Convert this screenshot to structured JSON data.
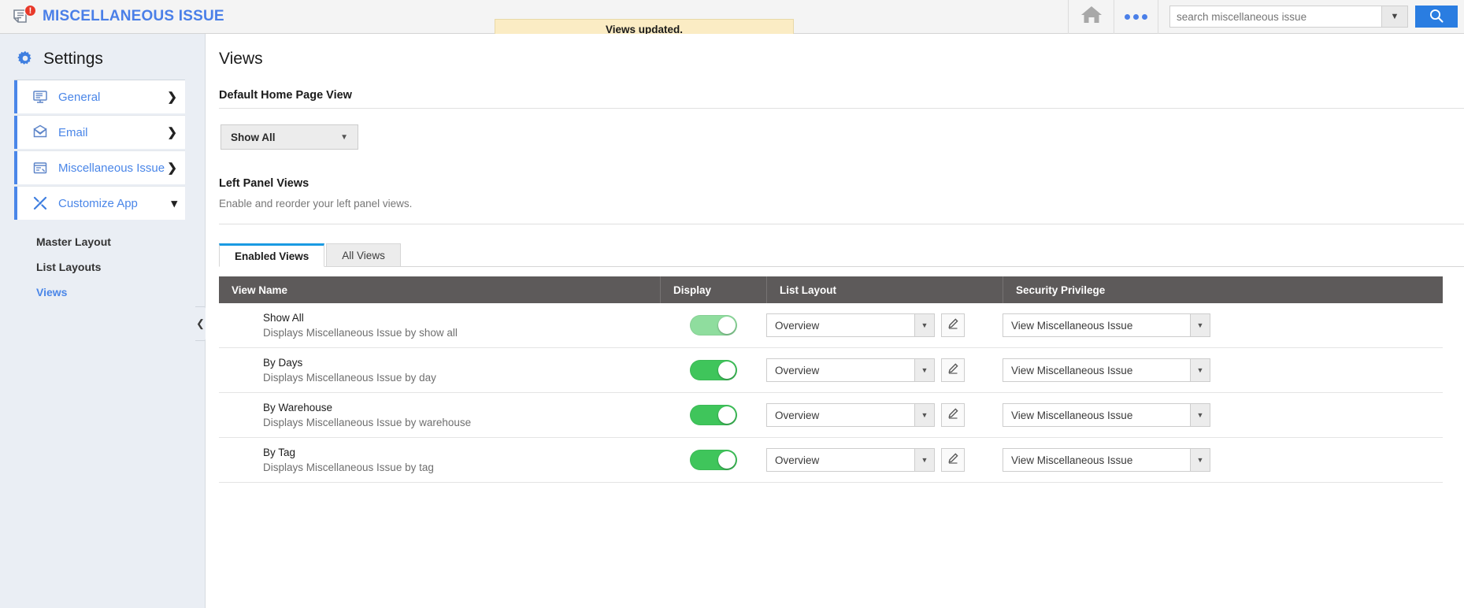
{
  "topbar": {
    "app_icon": "document-issue-icon",
    "badge_count": "!",
    "app_title": "MISCELLANEOUS ISSUE",
    "toast_message": "Views updated.",
    "home_icon": "home-icon",
    "more_icon": "more-options-icon",
    "search_placeholder": "search miscellaneous issue",
    "search_value": "",
    "search_dropdown_icon": "chevron-down-icon",
    "search_button_icon": "search-icon"
  },
  "sidebar": {
    "title": "Settings",
    "gear_icon": "gear-icon",
    "items": [
      {
        "label": "General",
        "icon": "monitor-icon",
        "chevron": "❯"
      },
      {
        "label": "Email",
        "icon": "envelope-icon",
        "chevron": "❯"
      },
      {
        "label": "Miscellaneous Issue",
        "icon": "window-list-icon",
        "chevron": "❯"
      },
      {
        "label": "Customize App",
        "icon": "tools-icon",
        "chevron": "❮"
      }
    ],
    "subnav": [
      {
        "label": "Master Layout",
        "active": false
      },
      {
        "label": "List Layouts",
        "active": false
      },
      {
        "label": "Views",
        "active": true
      }
    ],
    "collapse_icon": "chevron-left-icon"
  },
  "main": {
    "page_title": "Views",
    "default_home_section": {
      "label": "Default Home Page View",
      "select_value": "Show All",
      "caret_icon": "caret-down-icon"
    },
    "left_panel_section": {
      "label": "Left Panel Views",
      "description": "Enable and reorder your left panel views."
    },
    "tabs": [
      {
        "label": "Enabled Views",
        "active": true
      },
      {
        "label": "All Views",
        "active": false
      }
    ],
    "table": {
      "columns": [
        "View Name",
        "Display",
        "List Layout",
        "Security Privilege"
      ],
      "rows": [
        {
          "name": "Show All",
          "description": "Displays Miscellaneous Issue by show all",
          "display_on": true,
          "display_faded": true,
          "list_layout": "Overview",
          "edit_icon": "pencil-icon",
          "security_privilege": "View Miscellaneous Issue"
        },
        {
          "name": "By Days",
          "description": "Displays Miscellaneous Issue by day",
          "display_on": true,
          "display_faded": false,
          "list_layout": "Overview",
          "edit_icon": "pencil-icon",
          "security_privilege": "View Miscellaneous Issue"
        },
        {
          "name": "By Warehouse",
          "description": "Displays Miscellaneous Issue by warehouse",
          "display_on": true,
          "display_faded": false,
          "list_layout": "Overview",
          "edit_icon": "pencil-icon",
          "security_privilege": "View Miscellaneous Issue"
        },
        {
          "name": "By Tag",
          "description": "Displays Miscellaneous Issue by tag",
          "display_on": true,
          "display_faded": false,
          "list_layout": "Overview",
          "edit_icon": "pencil-icon",
          "security_privilege": "View Miscellaneous Issue"
        }
      ]
    }
  },
  "colors": {
    "brand_blue": "#4a7fe8",
    "accent_blue": "#2a7de1",
    "toggle_green": "#3fc55b",
    "toggle_green_faded": "#8fdd9e",
    "toast_bg": "#fbecc4",
    "sidebar_bg": "#eaeef4",
    "table_header_bg": "#5d5a5a",
    "tab_underline": "#1a9ae2"
  }
}
